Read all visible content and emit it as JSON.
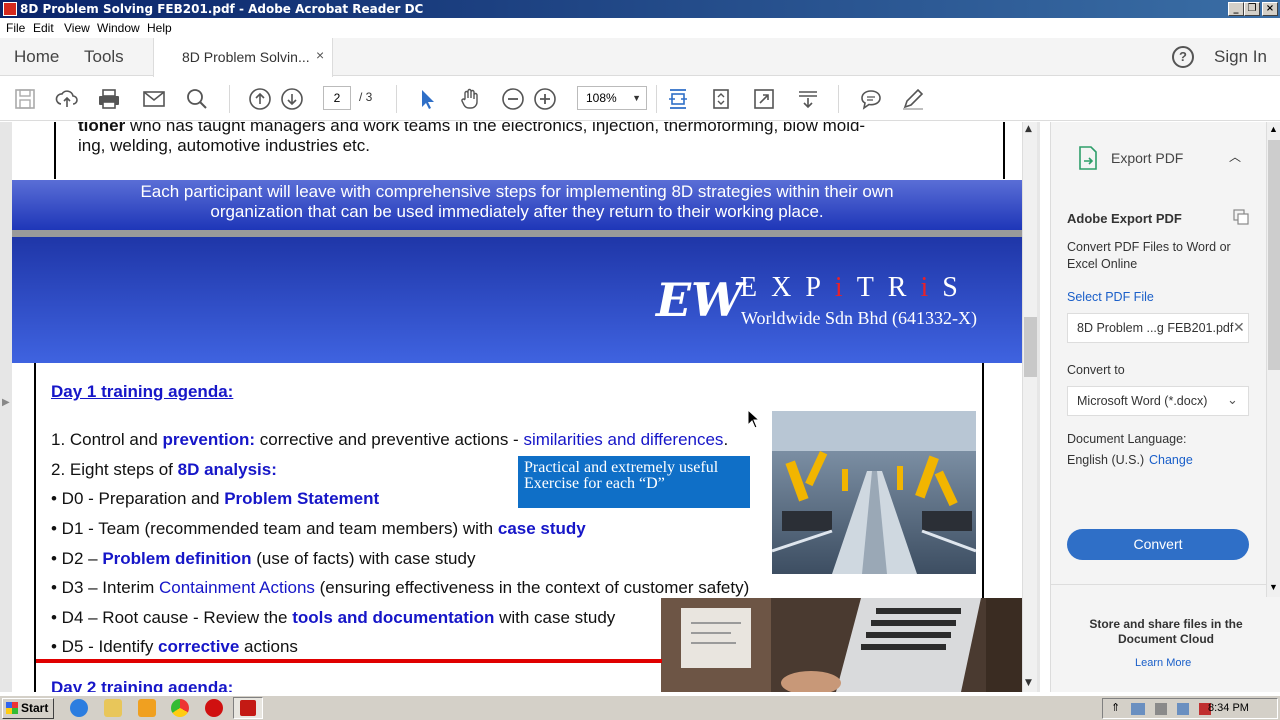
{
  "window": {
    "title": "8D Problem Solving FEB201.pdf - Adobe Acrobat Reader DC"
  },
  "menu": {
    "items": [
      "File",
      "Edit",
      "View",
      "Window",
      "Help"
    ]
  },
  "tabs": {
    "home": "Home",
    "tools": "Tools",
    "doc_tab": "8D Problem Solvin...",
    "close": "×",
    "help": "?",
    "sign_in": "Sign In"
  },
  "toolbar": {
    "page_current": "2",
    "page_total": "/ 3",
    "zoom": "108%"
  },
  "document": {
    "top_text": "tioner who has taught managers and work teams in the electronics, injection, thermoforming, blow mold- ing, welding, automotive industries etc.",
    "top_text_bold": "tioner",
    "top_text_rest": " who has taught managers and work teams in the electronics, injection, thermoforming, blow mold-",
    "top_text_line2": "ing, welding, automotive industries etc.",
    "banner_line1": "Each participant will leave with comprehensive steps for implementing 8D strategies within their own",
    "banner_line2": "organization that can be used immediately after they return to their working place.",
    "logo_mark": "EW",
    "logo_name_a": "EXP",
    "logo_name_i1": "i",
    "logo_name_b": "TR",
    "logo_name_i2": "i",
    "logo_name_c": "S",
    "logo_sub": "Worldwide Sdn Bhd (641332-X)",
    "day1_heading": "Day 1 training agenda:",
    "day2_heading": "Day 2 training agenda:",
    "callout_line1": "Practical and extremely useful",
    "callout_line2": "Exercise for each “D”",
    "agenda": {
      "l1_a": "1. Control and ",
      "l1_b": "prevention:",
      "l1_c": " corrective and preventive actions - ",
      "l1_d": "similarities and differences",
      "l1_e": ".",
      "l2_a": "2. Eight steps of ",
      "l2_b": "8D analysis:",
      "d0_a": "• D0 - Preparation and ",
      "d0_b": "Problem Statement",
      "d1_a": "• D1 - Team (recommended team and team members) with ",
      "d1_b": "case study",
      "d2_a": "• D2 – ",
      "d2_b": "Problem definition",
      "d2_c": " (use of facts) with case study",
      "d3_a": "• D3 – Interim ",
      "d3_b": "Containment Actions",
      "d3_c": " (ensuring effectiveness in the context of customer safety)",
      "d4_a": "• D4 – Root cause - Review the ",
      "d4_b": "tools and documentation",
      "d4_c": " with case study",
      "d5_a": "• D5 - Identify ",
      "d5_b": "corrective",
      "d5_c": " actions"
    }
  },
  "panel": {
    "title": "Export PDF",
    "heading": "Adobe Export PDF",
    "desc": "Convert PDF Files to Word or Excel Online",
    "select_file": "Select PDF File",
    "file_name": "8D Problem ...g FEB201.pdf",
    "convert_to": "Convert to",
    "format": "Microsoft Word (*.docx)",
    "doc_lang_label": "Document Language:",
    "doc_lang": "English (U.S.)",
    "change": "Change",
    "convert_btn": "Convert",
    "store": "Store and share files in the Document Cloud",
    "learn_more": "Learn More"
  },
  "taskbar": {
    "start": "Start",
    "clock": "8:34 PM"
  },
  "colors": {
    "accent": "#2f6fc7",
    "link": "#1616c8",
    "banner": "#1f36a8",
    "red": "#e00000"
  }
}
